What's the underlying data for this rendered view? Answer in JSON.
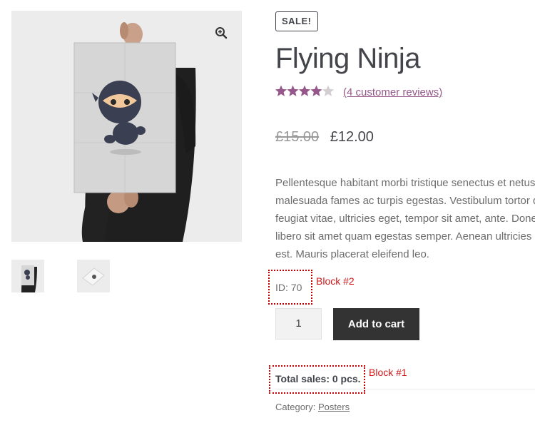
{
  "product": {
    "sale_badge": "SALE!",
    "title": "Flying Ninja",
    "rating": 4,
    "rating_max": 5,
    "reviews_link": "(4 customer reviews)",
    "price_old": "£15.00",
    "price_new": "£12.00",
    "description_lines": [
      "Pellentesque habitant morbi tristique senectus et netus",
      "malesuada fames ac turpis egestas. Vestibulum tortor q",
      "feugiat vitae, ultricies eget, tempor sit amet, ante. Done",
      "libero sit amet quam egestas semper. Aenean ultricies m",
      "est. Mauris placerat eleifend leo."
    ],
    "id_text": "ID: 70",
    "quantity": "1",
    "add_to_cart_label": "Add to cart",
    "total_sales": "Total sales: 0 pcs.",
    "category_label": "Category:",
    "category_link": "Posters"
  },
  "annotations": {
    "block2_label": "Block #2",
    "block1_label": "Block #1"
  },
  "colors": {
    "accent": "#96588a",
    "button_bg": "#333333",
    "annotation_red": "#d01818"
  },
  "icons": {
    "zoom": "zoom-in-icon",
    "star": "star-icon"
  }
}
